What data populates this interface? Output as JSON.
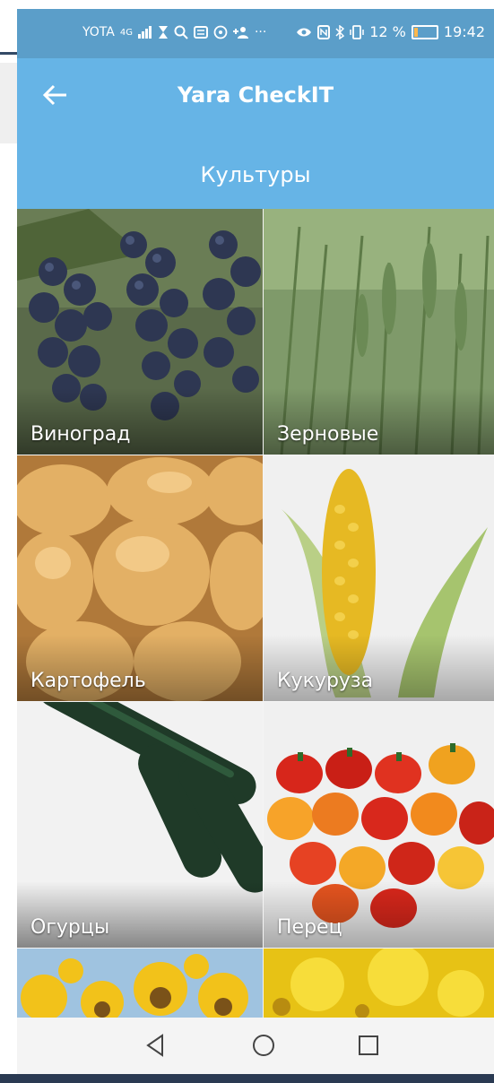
{
  "status_bar": {
    "carrier": "YOTA",
    "network": "4G",
    "battery_percent": "12 %",
    "time": "19:42",
    "icons": [
      "signal-icon",
      "hourglass-icon",
      "search-icon",
      "message-icon",
      "viber-icon",
      "add-contact-icon",
      "more-icon",
      "eye-icon",
      "nfc-icon",
      "bluetooth-icon",
      "vibrate-icon",
      "battery-icon"
    ]
  },
  "app_bar": {
    "title": "Yara CheckIT",
    "back_icon": "arrow-left-icon"
  },
  "section": {
    "title": "Культуры"
  },
  "crops": [
    {
      "label": "Виноград"
    },
    {
      "label": "Зерновые"
    },
    {
      "label": "Картофель"
    },
    {
      "label": "Кукуруза"
    },
    {
      "label": "Огурцы"
    },
    {
      "label": "Перец"
    },
    {
      "label": ""
    },
    {
      "label": ""
    }
  ],
  "nav_bar": {
    "back": "triangle-back-icon",
    "home": "circle-home-icon",
    "recents": "square-recents-icon"
  },
  "colors": {
    "status_bar": "#5b9ec9",
    "app_bar": "#66b4e6",
    "nav_bar": "#f4f4f4"
  }
}
